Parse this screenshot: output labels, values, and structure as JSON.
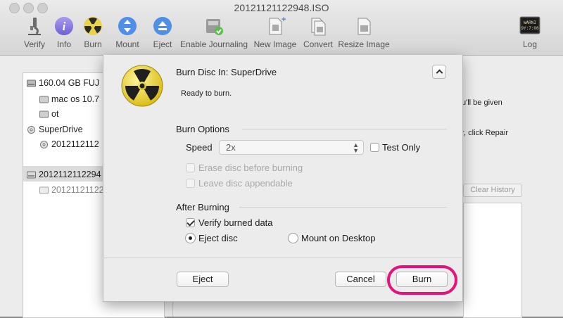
{
  "window": {
    "title": "20121121122948.ISO"
  },
  "toolbar": {
    "items": [
      {
        "label": "Verify",
        "icon": "microscope-icon"
      },
      {
        "label": "Info",
        "icon": "info-icon"
      },
      {
        "label": "Burn",
        "icon": "radiation-icon"
      },
      {
        "label": "Mount",
        "icon": "mount-icon"
      },
      {
        "label": "Eject",
        "icon": "eject-icon"
      },
      {
        "label": "Enable Journaling",
        "icon": "disk-check-icon"
      },
      {
        "label": "New Image",
        "icon": "new-image-icon"
      },
      {
        "label": "Convert",
        "icon": "convert-icon"
      },
      {
        "label": "Resize Image",
        "icon": "resize-image-icon"
      },
      {
        "label": "Log",
        "icon": "log-icon"
      }
    ],
    "log_icon_text": "WARNI\n9Y:7:06"
  },
  "sidebar": {
    "items": [
      {
        "label": "160.04 GB FUJ",
        "icon": "hard-disk-icon"
      },
      {
        "label": "mac os 10.7",
        "icon": "volume-icon"
      },
      {
        "label": "ot",
        "icon": "volume-icon"
      },
      {
        "label": "SuperDrive",
        "icon": "optical-drive-icon"
      },
      {
        "label": "2012112112",
        "icon": "disc-icon"
      },
      {
        "label": "2012112112294",
        "icon": "disk-image-icon"
      },
      {
        "label": "20121121122",
        "icon": "disk-image-icon"
      }
    ]
  },
  "background_pane": {
    "text_line_1": "u'll be given",
    "text_line_2": "r, click Repair",
    "clear_history_label": "Clear History"
  },
  "sheet": {
    "title_prefix": "Burn Disc In:",
    "drive": "SuperDrive",
    "status": "Ready to burn.",
    "burn_options_header": "Burn Options",
    "speed_label": "Speed",
    "speed_value": "2x",
    "test_only_label": "Test Only",
    "test_only_checked": false,
    "erase_label": "Erase disc before burning",
    "leave_appendable_label": "Leave disc appendable",
    "after_burning_header": "After Burning",
    "verify_label": "Verify burned data",
    "verify_checked": true,
    "eject_disc_label": "Eject disc",
    "mount_desktop_label": "Mount on Desktop",
    "after_choice": "Eject disc",
    "buttons": {
      "eject": "Eject",
      "cancel": "Cancel",
      "burn": "Burn"
    },
    "highlight_color": "#e5147b"
  }
}
